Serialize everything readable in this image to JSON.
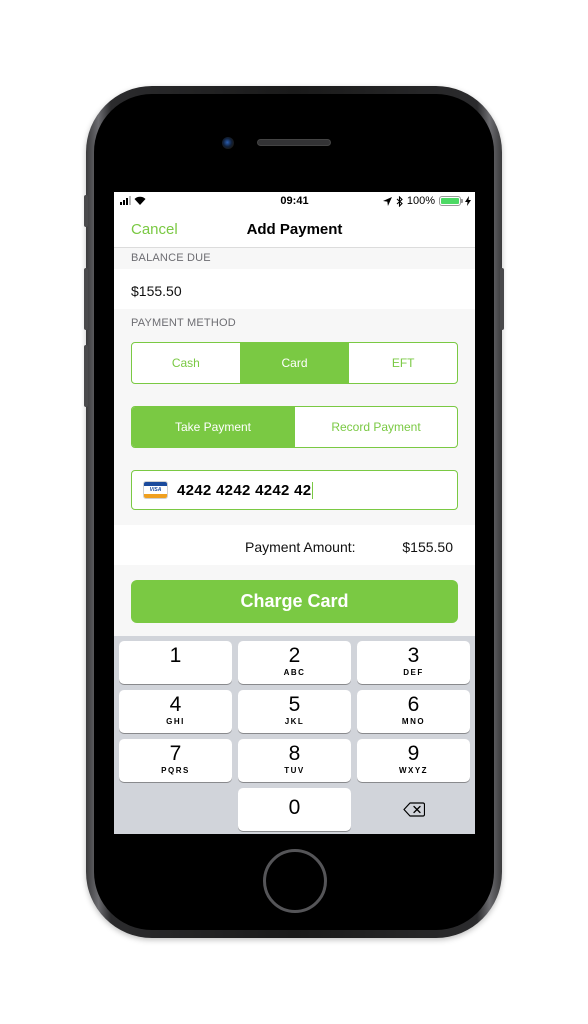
{
  "status_bar": {
    "time": "09:41",
    "battery": "100%",
    "icons": [
      "signal-icon",
      "wifi-icon",
      "location-icon",
      "bluetooth-icon",
      "battery-icon",
      "charging-icon"
    ]
  },
  "nav": {
    "cancel_label": "Cancel",
    "title": "Add Payment"
  },
  "balance": {
    "header": "BALANCE DUE",
    "value": "$155.50"
  },
  "payment_method": {
    "header": "PAYMENT METHOD",
    "options": [
      {
        "label": "Cash",
        "selected": false
      },
      {
        "label": "Card",
        "selected": true
      },
      {
        "label": "EFT",
        "selected": false
      }
    ]
  },
  "payment_mode": {
    "options": [
      {
        "label": "Take Payment",
        "selected": true
      },
      {
        "label": "Record Payment",
        "selected": false
      }
    ]
  },
  "card_field": {
    "card_brand": "VISA",
    "value": "4242 4242 4242 42"
  },
  "payment_amount": {
    "label": "Payment Amount:",
    "value": "$155.50"
  },
  "charge_button": {
    "label": "Charge Card"
  },
  "keypad": {
    "keys": [
      {
        "num": "1",
        "letters": ""
      },
      {
        "num": "2",
        "letters": "ABC"
      },
      {
        "num": "3",
        "letters": "DEF"
      },
      {
        "num": "4",
        "letters": "GHI"
      },
      {
        "num": "5",
        "letters": "JKL"
      },
      {
        "num": "6",
        "letters": "MNO"
      },
      {
        "num": "7",
        "letters": "PQRS"
      },
      {
        "num": "8",
        "letters": "TUV"
      },
      {
        "num": "9",
        "letters": "WXYZ"
      },
      {
        "num": "0",
        "letters": ""
      }
    ],
    "delete_icon": "backspace-icon"
  },
  "colors": {
    "accent": "#7ac943",
    "keypad_bg": "#d1d4da",
    "screen_bg": "#f7f7f7"
  }
}
